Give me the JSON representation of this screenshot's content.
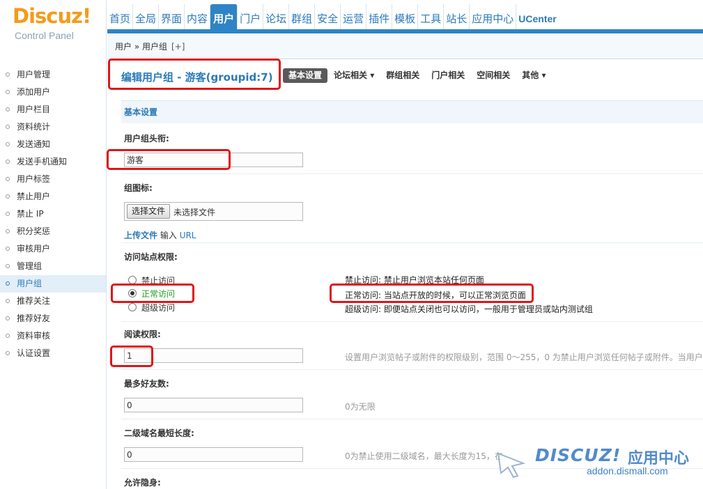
{
  "logo": {
    "brand": "Discuz",
    "bang": "!",
    "subtitle": "Control Panel"
  },
  "topnav": [
    {
      "label": "首页"
    },
    {
      "label": "全局"
    },
    {
      "label": "界面"
    },
    {
      "label": "内容"
    },
    {
      "label": "用户",
      "active": true
    },
    {
      "label": "门户"
    },
    {
      "label": "论坛"
    },
    {
      "label": "群组"
    },
    {
      "label": "安全"
    },
    {
      "label": "运营"
    },
    {
      "label": "插件"
    },
    {
      "label": "模板"
    },
    {
      "label": "工具"
    },
    {
      "label": "站长"
    },
    {
      "label": "应用中心"
    },
    {
      "label": "UCenter"
    }
  ],
  "breadcrumb": {
    "text": "用户 » 用户组",
    "add": "[+]"
  },
  "sidebar": {
    "items": [
      {
        "label": "用户管理"
      },
      {
        "label": "添加用户"
      },
      {
        "label": "用户栏目"
      },
      {
        "label": "资料统计"
      },
      {
        "label": "发送通知"
      },
      {
        "label": "发送手机通知"
      },
      {
        "label": "用户标签"
      },
      {
        "label": "禁止用户"
      },
      {
        "label": "禁止 IP"
      },
      {
        "label": "积分奖惩"
      },
      {
        "label": "审核用户"
      },
      {
        "label": "管理组"
      },
      {
        "label": "用户组",
        "active": true
      },
      {
        "label": "推荐关注"
      },
      {
        "label": "推荐好友"
      },
      {
        "label": "资料审核"
      },
      {
        "label": "认证设置"
      }
    ]
  },
  "page": {
    "title": "编辑用户组 - 游客(groupid:7)",
    "tabs": [
      {
        "label": "基本设置",
        "active": true
      },
      {
        "label": "论坛相关 ▾"
      },
      {
        "label": "群组相关"
      },
      {
        "label": "门户相关"
      },
      {
        "label": "空间相关"
      },
      {
        "label": "其他 ▾"
      }
    ]
  },
  "form": {
    "section_title": "基本设置",
    "group_title": {
      "label": "用户组头衔:",
      "value": "游客"
    },
    "group_icon": {
      "label": "组图标:",
      "file_button": "选择文件",
      "file_status": "未选择文件",
      "upload_label": "上传文件",
      "input_label": "输入",
      "url_label": "URL"
    },
    "access": {
      "label": "访问站点权限:",
      "options": [
        {
          "label": "禁止访问",
          "checked": false
        },
        {
          "label": "正常访问",
          "checked": true
        },
        {
          "label": "超级访问",
          "checked": false
        }
      ],
      "descriptions": [
        "禁止访问: 禁止用户浏览本站任何页面",
        "正常访问: 当站点开放的时候，可以正常浏览页面",
        "超级访问: 即便站点关闭也可以访问，一般用于管理员或站内测试组"
      ]
    },
    "read_access": {
      "label": "阅读权限:",
      "value": "1",
      "tip": "设置用户浏览帖子或附件的权限级别，范围 0～255，0 为禁止用户浏览任何帖子或附件。当用户"
    },
    "max_friends": {
      "label": "最多好友数:",
      "value": "0",
      "tip": "0为无限"
    },
    "domain_length": {
      "label": "二级域名最短长度:",
      "value": "0",
      "tip": "0为禁止使用二级域名，最大长度为15，在"
    },
    "invisible": {
      "label": "允许隐身:"
    }
  },
  "watermark": {
    "logo": "DISCUZ!",
    "cn": "应用中心",
    "url": "addon.dismall.com"
  },
  "colors": {
    "accent": "#2e84c6",
    "highlight": "#e01515",
    "logo_orange": "#f49b1b"
  }
}
